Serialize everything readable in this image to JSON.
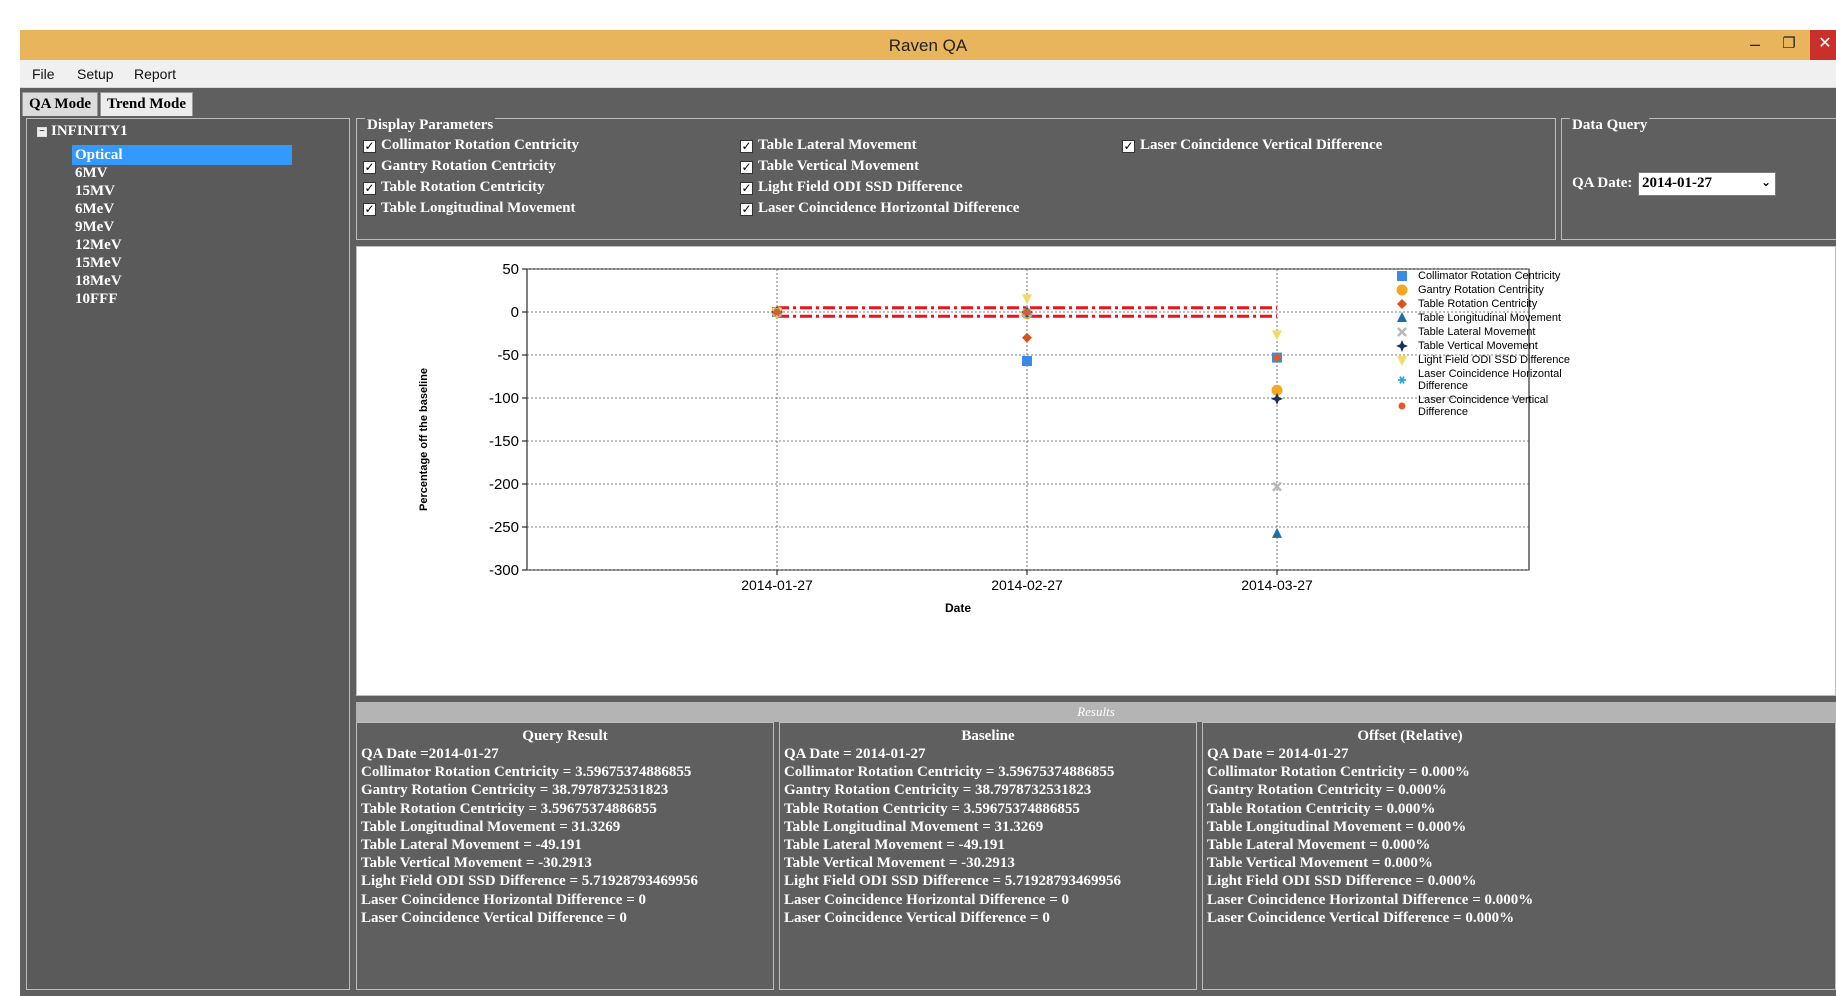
{
  "window": {
    "title": "Raven QA"
  },
  "menu": {
    "file": "File",
    "setup": "Setup",
    "report": "Report"
  },
  "tabs": {
    "qa_mode": "QA Mode",
    "trend_mode": "Trend Mode"
  },
  "tree": {
    "root": "INFINITY1",
    "items": [
      "Optical",
      "6MV",
      "15MV",
      "6MeV",
      "9MeV",
      "12MeV",
      "15MeV",
      "18MeV",
      "10FFF"
    ],
    "selected": "Optical"
  },
  "display_parameters": {
    "title": "Display Parameters",
    "items": [
      "Collimator Rotation Centricity",
      "Gantry Rotation Centricity",
      "Table Rotation Centricity",
      "Table Longitudinal Movement",
      "Table Lateral Movement",
      "Table Vertical Movement",
      "Light Field ODI SSD Difference",
      "Laser Coincidence Horizontal Difference",
      "Laser Coincidence Vertical Difference"
    ],
    "all_checked": true
  },
  "data_query": {
    "title": "Data Query",
    "qa_date_label": "QA Date:",
    "qa_date_value": "2014-01-27"
  },
  "chart_data": {
    "type": "scatter",
    "xlabel": "Date",
    "ylabel": "Percentage off the baseline",
    "categories": [
      "2014-01-27",
      "2014-02-27",
      "2014-03-27"
    ],
    "ylim": [
      -300,
      50
    ],
    "yticks": [
      50,
      0,
      -50,
      -100,
      -150,
      -200,
      -250,
      -300
    ],
    "grid": true,
    "legend_position": "right",
    "threshold_lines": [
      5,
      -5
    ],
    "series": [
      {
        "name": "Collimator Rotation Centricity",
        "color": "#3c8ae6",
        "marker": "square",
        "values": [
          0,
          -57,
          -53
        ]
      },
      {
        "name": "Gantry Rotation Centricity",
        "color": "#f5a623",
        "marker": "circle",
        "values": [
          0,
          -2,
          -91
        ]
      },
      {
        "name": "Table Rotation Centricity",
        "color": "#d9531e",
        "marker": "diamond",
        "values": [
          0,
          -30,
          -53
        ]
      },
      {
        "name": "Table Longitudinal Movement",
        "color": "#1a6fa5",
        "marker": "triangle",
        "values": [
          0,
          -1,
          -258
        ]
      },
      {
        "name": "Table Lateral Movement",
        "color": "#b8b8b8",
        "marker": "cross",
        "values": [
          0,
          -1,
          -203
        ]
      },
      {
        "name": "Table Vertical Movement",
        "color": "#1b2f5a",
        "marker": "star4",
        "values": [
          0,
          0,
          -101
        ]
      },
      {
        "name": "Light Field ODI SSD Difference",
        "color": "#f4d96b",
        "marker": "triangle-down",
        "values": [
          0,
          16,
          -26
        ]
      },
      {
        "name": "Laser Coincidence Horizontal Difference",
        "color": "#2aa8d8",
        "marker": "asterisk",
        "values": [
          0,
          0,
          -53
        ]
      },
      {
        "name": "Laser Coincidence Vertical Difference",
        "color": "#e05a2a",
        "marker": "circle-small",
        "values": [
          0,
          0,
          -53
        ]
      }
    ]
  },
  "results": {
    "header": "Results",
    "query_result": {
      "title": "Query Result",
      "lines": [
        "QA Date =2014-01-27",
        "Collimator Rotation Centricity = 3.59675374886855",
        "Gantry Rotation Centricity = 38.7978732531823",
        "Table Rotation Centricity = 3.59675374886855",
        "Table Longitudinal Movement = 31.3269",
        "Table Lateral Movement = -49.191",
        "Table Vertical Movement = -30.2913",
        "Light Field ODI SSD Difference = 5.71928793469956",
        "Laser Coincidence Horizontal Difference = 0",
        "Laser Coincidence Vertical Difference = 0"
      ]
    },
    "baseline": {
      "title": "Baseline",
      "lines": [
        "QA Date = 2014-01-27",
        "Collimator Rotation Centricity = 3.59675374886855",
        "Gantry Rotation Centricity = 38.7978732531823",
        "Table Rotation Centricity = 3.59675374886855",
        "Table Longitudinal Movement = 31.3269",
        "Table Lateral Movement = -49.191",
        "Table Vertical Movement = -30.2913",
        "Light Field ODI SSD Difference = 5.71928793469956",
        "Laser Coincidence Horizontal Difference = 0",
        "Laser Coincidence Vertical Difference = 0"
      ]
    },
    "offset": {
      "title": "Offset (Relative)",
      "lines": [
        "QA Date = 2014-01-27",
        "Collimator Rotation Centricity = 0.000%",
        "Gantry Rotation Centricity = 0.000%",
        "Table Rotation Centricity = 0.000%",
        "Table Longitudinal Movement = 0.000%",
        "Table Lateral Movement = 0.000%",
        "Table Vertical Movement = 0.000%",
        "Light Field ODI SSD Difference = 0.000%",
        "Laser Coincidence Horizontal Difference = 0.000%",
        "Laser Coincidence Vertical Difference = 0.000%"
      ]
    }
  }
}
